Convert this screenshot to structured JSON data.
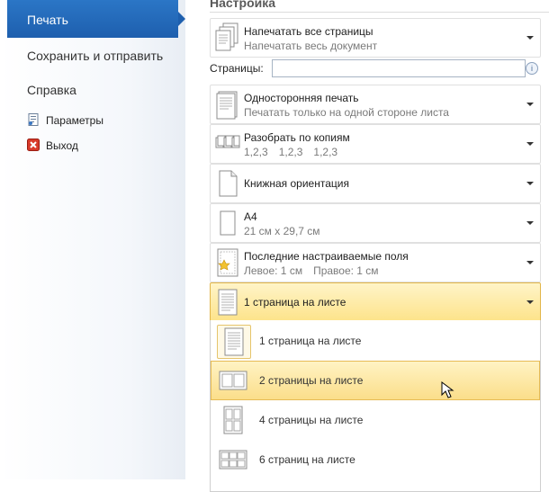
{
  "nav": {
    "active_label": "Печать",
    "items": [
      {
        "label": "Сохранить и отправить"
      },
      {
        "label": "Справка"
      }
    ],
    "subitems": [
      {
        "label": "Параметры",
        "icon": "document-options-icon"
      },
      {
        "label": "Выход",
        "icon": "exit-icon"
      }
    ]
  },
  "panel": {
    "title": "Настройка",
    "print_range": {
      "title": "Напечатать все страницы",
      "subtitle": "Напечатать весь документ"
    },
    "pages": {
      "label": "Страницы:",
      "value": ""
    },
    "sides": {
      "title": "Односторонняя печать",
      "subtitle": "Печатать только на одной стороне листа"
    },
    "collate": {
      "title": "Разобрать по копиям",
      "subtitle": [
        "1,2,3",
        "1,2,3",
        "1,2,3"
      ]
    },
    "orientation": {
      "title": "Книжная ориентация"
    },
    "paper": {
      "title": "А4",
      "subtitle": "21 см x 29,7 см"
    },
    "margins": {
      "title": "Последние настраиваемые поля",
      "left": "Левое:  1 см",
      "right": "Правое:  1 см"
    },
    "pages_per_sheet": {
      "title": "1 страница на листе"
    }
  },
  "dropdown": {
    "items": [
      {
        "label": "1 страница на листе"
      },
      {
        "label": "2 страницы на листе"
      },
      {
        "label": "4 страницы на листе"
      },
      {
        "label": "6 страниц на листе"
      }
    ],
    "hover_index": 1
  },
  "colors": {
    "nav_active": "#1e5fae",
    "selected_fill": "#fde38a",
    "selected_border": "#e2b64a"
  }
}
